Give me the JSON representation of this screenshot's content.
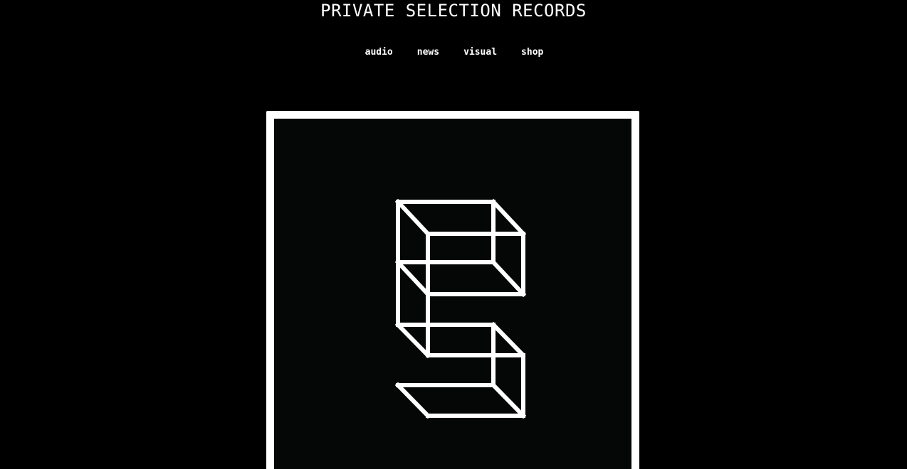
{
  "header": {
    "title": "PRIVATE SELECTION RECORDS"
  },
  "nav": {
    "items": [
      {
        "label": "audio"
      },
      {
        "label": "news"
      },
      {
        "label": "visual"
      },
      {
        "label": "shop"
      }
    ]
  },
  "artwork": {
    "frame_color": "#ffffff",
    "background_color": "#050707",
    "logo": "S-wireframe-cube-logo"
  }
}
